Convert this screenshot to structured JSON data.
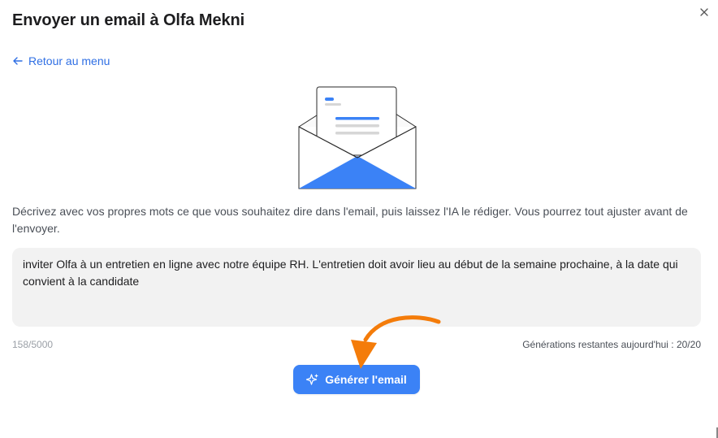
{
  "modal": {
    "title": "Envoyer un email à Olfa Mekni",
    "close_icon": "close-icon"
  },
  "back": {
    "label": "Retour au menu",
    "icon": "arrow-left-icon"
  },
  "illustration": {
    "icon": "envelope-illustration"
  },
  "description": "Décrivez avec vos propres mots ce que vous souhaitez dire dans l'email, puis laissez l'IA le rédiger. Vous pourrez tout ajuster avant de l'envoyer.",
  "prompt": {
    "value": "inviter Olfa à un entretien en ligne avec notre équipe RH. L'entretien doit avoir lieu au début de la semaine prochaine, à la date qui convient à la candidate"
  },
  "counter": "158/5000",
  "remaining": "Générations restantes aujourd'hui : 20/20",
  "generate": {
    "label": "Générer l'email",
    "icon": "sparkle-icon"
  },
  "annotation": {
    "icon": "annotation-arrow-icon",
    "color": "#f47c0a"
  },
  "colors": {
    "accent": "#3b82f6",
    "link": "#2f6fe4",
    "annotation": "#f47c0a"
  }
}
